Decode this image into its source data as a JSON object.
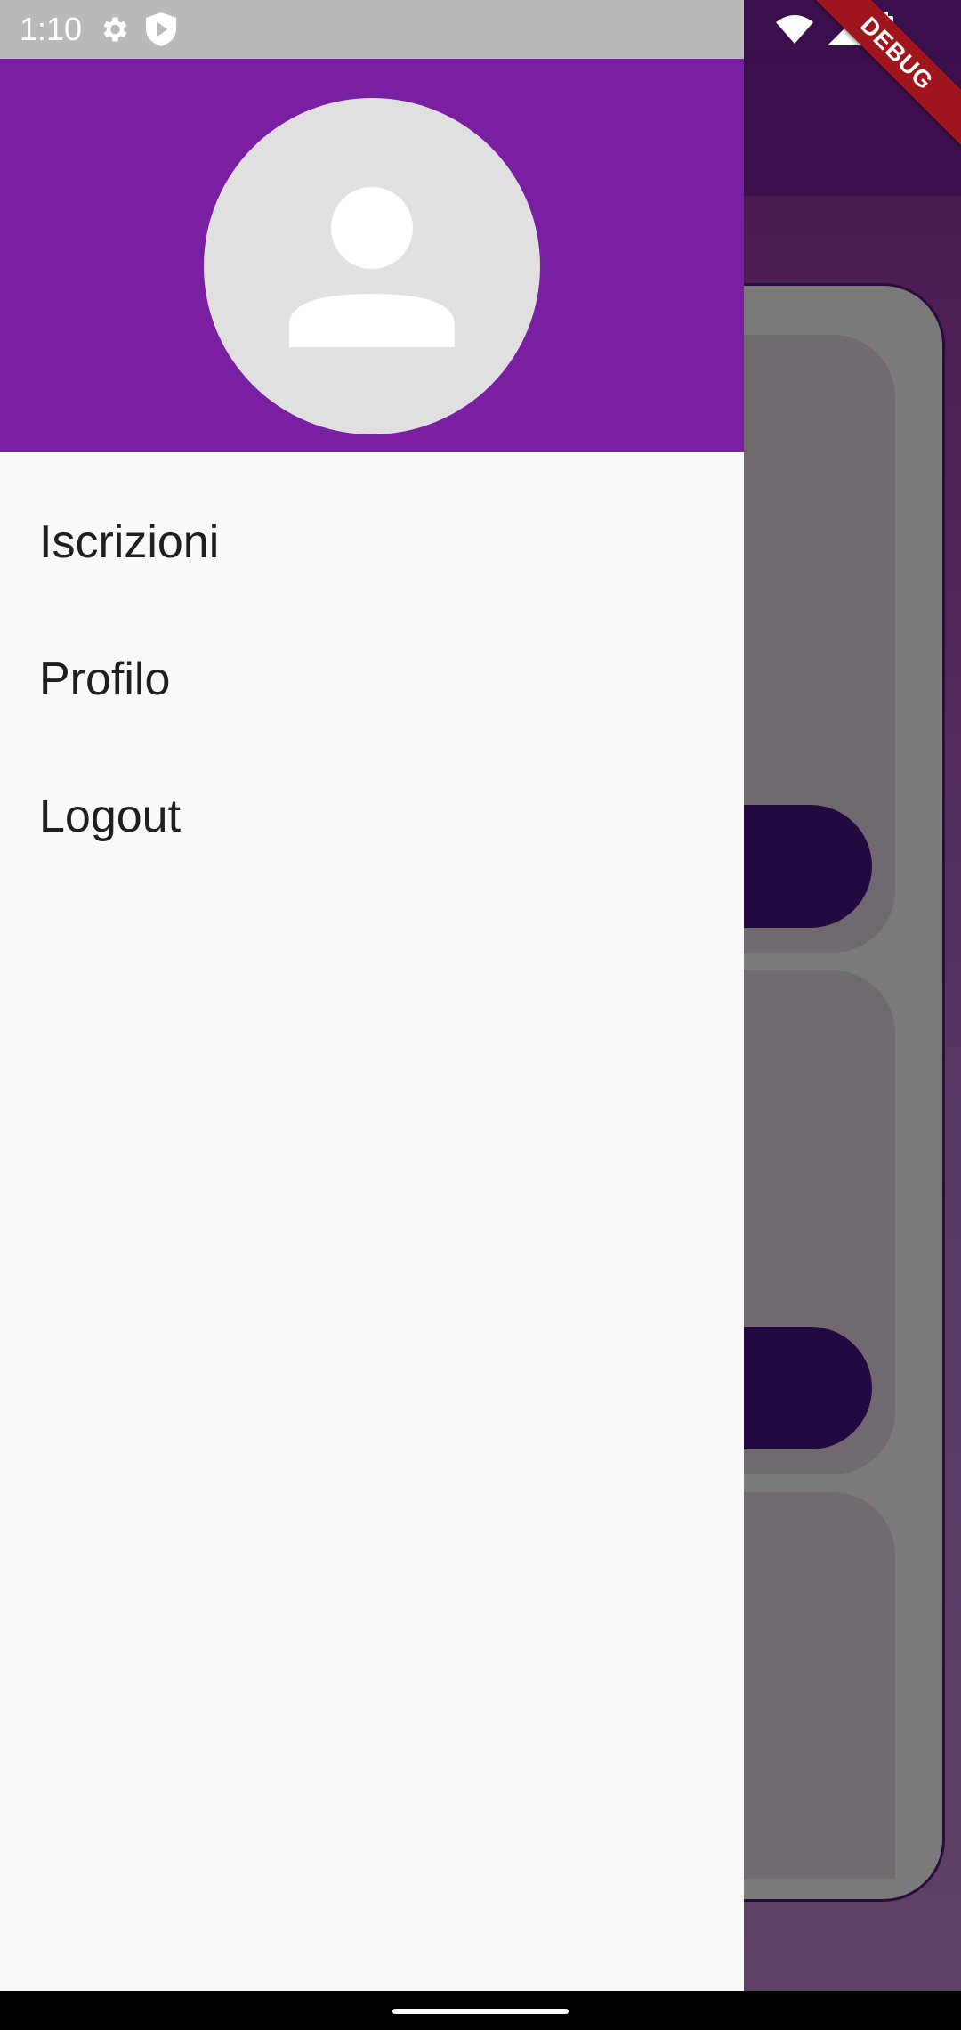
{
  "status_bar": {
    "time": "1:10",
    "left_icons": [
      "gear-icon",
      "shield-play-icon"
    ],
    "right_icons": [
      "wifi-icon",
      "cellular-signal-icon",
      "battery-icon"
    ]
  },
  "debug_banner": {
    "label": "DEBUG"
  },
  "drawer": {
    "header_color": "#7b1fa2",
    "avatar_icon": "person-icon",
    "menu": [
      {
        "label": "Iscrizioni"
      },
      {
        "label": "Profilo"
      },
      {
        "label": "Logout"
      }
    ]
  },
  "colors": {
    "scrim_background": "#5c3e63",
    "button_dark": "#220a40",
    "drawer_background": "#f9f9f9"
  }
}
